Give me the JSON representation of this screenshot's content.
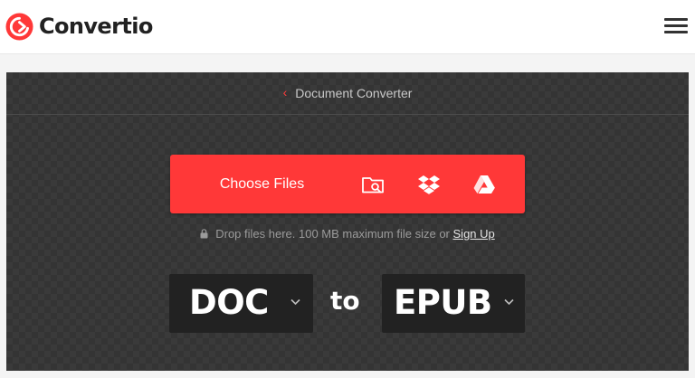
{
  "header": {
    "brand": "Convertio",
    "logo_icon": "convertio-logo-icon",
    "menu_icon": "hamburger-menu-icon"
  },
  "breadcrumb": {
    "back_icon": "chevron-left-icon",
    "label": "Document Converter"
  },
  "upload": {
    "choose_label": "Choose Files",
    "sources": [
      {
        "name": "local-folder-icon"
      },
      {
        "name": "dropbox-icon"
      },
      {
        "name": "google-drive-icon"
      }
    ],
    "hint_text": "Drop files here. 100 MB maximum file size or",
    "signup_label": "Sign Up"
  },
  "conversion": {
    "from_format": "DOC",
    "to_label": "to",
    "to_format": "EPUB"
  },
  "colors": {
    "accent": "#ff3838",
    "panel_bg": "#3a3a3a",
    "selector_bg": "#222222"
  }
}
